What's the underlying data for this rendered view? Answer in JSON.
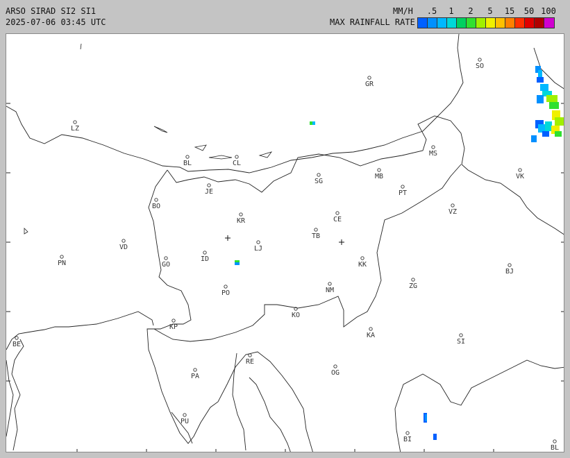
{
  "header": {
    "title": "ARSO SIRAD SI2 SI1",
    "timestamp": "2025-07-06 03:45 UTC",
    "units": "MM/H",
    "legend_label": "MAX RAINFALL RATE"
  },
  "legend": {
    "labels": [
      ".5",
      "1",
      "2",
      "5",
      "15",
      "50",
      "100"
    ],
    "colors": [
      "#0060ff",
      "#0090ff",
      "#00b8ff",
      "#00d8d8",
      "#00d060",
      "#30e030",
      "#a0f000",
      "#f0f000",
      "#ffc000",
      "#ff8000",
      "#ff3000",
      "#e00000",
      "#b00000",
      "#d000d0"
    ]
  },
  "map": {
    "cities": [
      {
        "code": "SO"
      },
      {
        "code": "GR"
      },
      {
        "code": "LZ"
      },
      {
        "code": "MS"
      },
      {
        "code": "BL"
      },
      {
        "code": "CL"
      },
      {
        "code": "MB"
      },
      {
        "code": "VK"
      },
      {
        "code": "JE"
      },
      {
        "code": "SG"
      },
      {
        "code": "PT"
      },
      {
        "code": "BO"
      },
      {
        "code": "KR"
      },
      {
        "code": "CE"
      },
      {
        "code": "VZ"
      },
      {
        "code": "TB"
      },
      {
        "code": "VD"
      },
      {
        "code": "LJ"
      },
      {
        "code": "PN"
      },
      {
        "code": "ID"
      },
      {
        "code": "GO"
      },
      {
        "code": "KK"
      },
      {
        "code": "BJ"
      },
      {
        "code": "ZG"
      },
      {
        "code": "PO"
      },
      {
        "code": "NM"
      },
      {
        "code": "KO"
      },
      {
        "code": "KP"
      },
      {
        "code": "KA"
      },
      {
        "code": "SI"
      },
      {
        "code": "BE"
      },
      {
        "code": "RE"
      },
      {
        "code": "PA"
      },
      {
        "code": "OG"
      },
      {
        "code": "PU"
      },
      {
        "code": "BI"
      },
      {
        "code": "BL"
      }
    ],
    "radar_sites": [
      "Lisca",
      "Pasja ravan"
    ]
  }
}
